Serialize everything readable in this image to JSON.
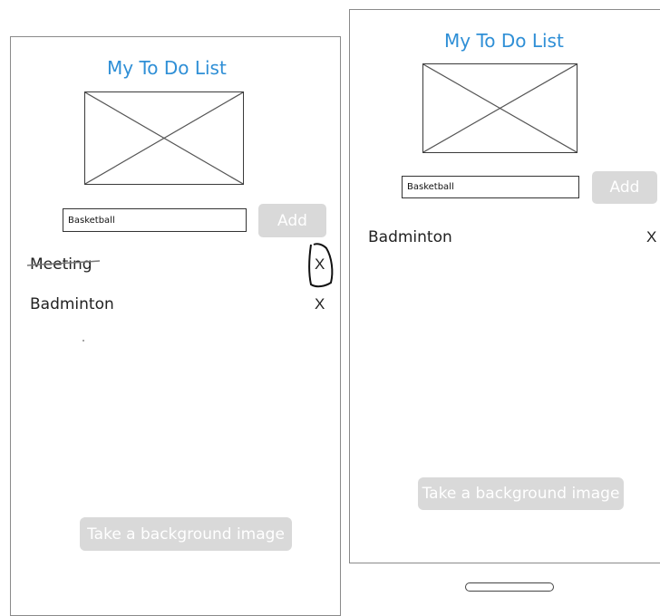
{
  "left_screen": {
    "title": "My To Do List",
    "input_value": "Basketball",
    "add_label": "Add",
    "items": [
      {
        "label": "Meeting",
        "delete_label": "X",
        "completed": true
      },
      {
        "label": "Badminton",
        "delete_label": "X",
        "completed": false
      }
    ],
    "background_button_label": "Take a background image"
  },
  "right_screen": {
    "title": "My To Do List",
    "input_value": "Basketball",
    "add_label": "Add",
    "items": [
      {
        "label": "Badminton",
        "delete_label": "X",
        "completed": false
      }
    ],
    "background_button_label": "Take a background image"
  },
  "colors": {
    "title": "#2f8fd6",
    "disabled_button": "#d9d9d9",
    "text": "#222222"
  },
  "icons": {
    "image_placeholder": "image-placeholder-icon",
    "delete": "close-icon"
  }
}
